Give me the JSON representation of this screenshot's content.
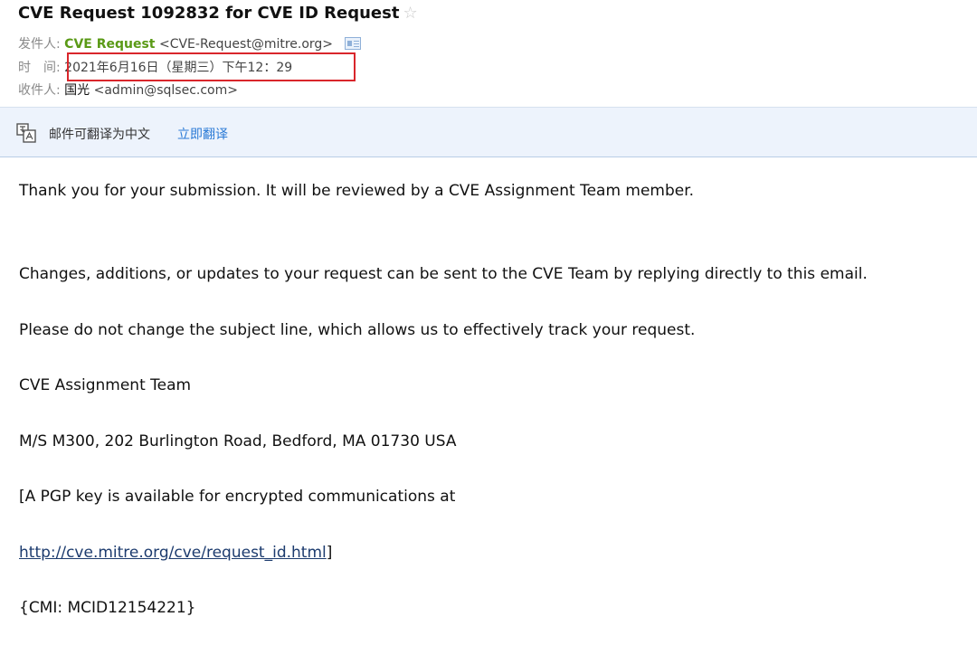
{
  "email": {
    "subject": "CVE Request 1092832 for CVE ID Request",
    "from_label": "发件人:",
    "from_name": "CVE Request",
    "from_address": "<CVE-Request@mitre.org>",
    "time_label": "时　间:",
    "time_value": "2021年6月16日（星期三）下午12：29",
    "to_label": "收件人:",
    "to_name": "国光",
    "to_address": "<admin@sqlsec.com>"
  },
  "translate_bar": {
    "text": "邮件可翻译为中文",
    "action": "立即翻译"
  },
  "body": {
    "p1": "Thank you for your submission. It will be reviewed by a CVE Assignment Team member.",
    "p2": "Changes, additions, or updates to your request can be sent to the CVE Team by replying directly to this email.",
    "p3": "Please do not change the subject line, which allows us to effectively track your request.",
    "p4": "CVE Assignment Team",
    "p5": "M/S M300, 202 Burlington Road, Bedford, MA 01730 USA",
    "p6": "[A PGP key is available for encrypted communications at",
    "link": "http://cve.mitre.org/cve/request_id.html",
    "link_suffix": "]",
    "p8": "{CMI: MCID12154221}"
  },
  "icons": {
    "star": "star-icon",
    "contact_card": "contact-card-icon",
    "translate": "translate-icon"
  },
  "colors": {
    "sender": "#5a9a16",
    "highlight_box": "#d9262b",
    "translate_bg": "#edf3fc",
    "action_link": "#2a7ad6",
    "body_link": "#1c3b6e"
  }
}
